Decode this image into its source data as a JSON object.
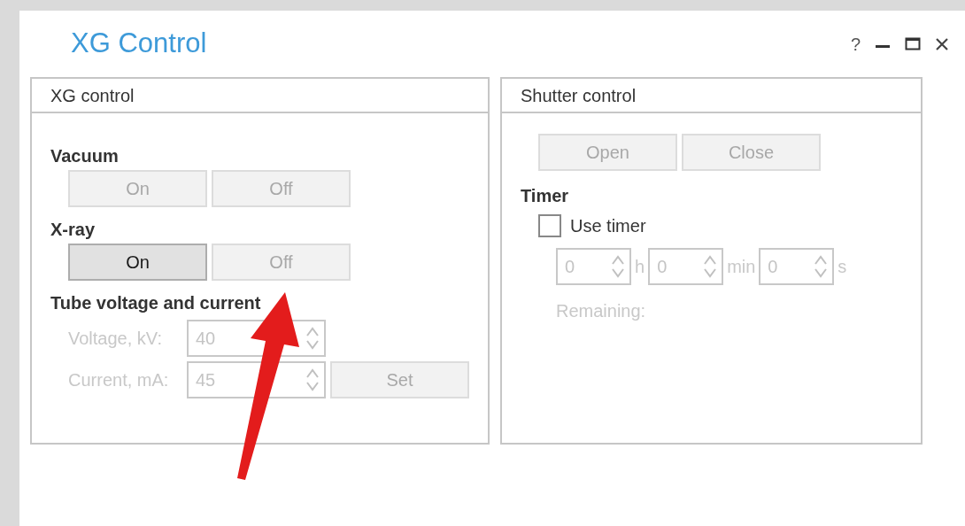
{
  "window": {
    "title": "XG Control",
    "help": "?"
  },
  "xg_panel": {
    "title": "XG control",
    "sections": [
      {
        "label": "Vacuum",
        "buttons": [
          {
            "label": "On",
            "disabled": true
          },
          {
            "label": "Off",
            "disabled": true
          }
        ]
      },
      {
        "label": "X-ray",
        "buttons": [
          {
            "label": "On",
            "disabled": false
          },
          {
            "label": "Off",
            "disabled": true
          }
        ]
      }
    ],
    "tube": {
      "label": "Tube voltage and current",
      "fields": [
        {
          "label": "Voltage, kV:",
          "value": "40",
          "disabled": true
        },
        {
          "label": "Current, mA:",
          "value": "45",
          "disabled": true
        }
      ],
      "set_button": {
        "label": "Set",
        "disabled": true
      }
    }
  },
  "shutter_panel": {
    "title": "Shutter control",
    "buttons": [
      {
        "label": "Open",
        "disabled": true
      },
      {
        "label": "Close",
        "disabled": true
      }
    ],
    "timer": {
      "label": "Timer",
      "use_timer": {
        "label": "Use timer",
        "checked": false
      },
      "fields": [
        {
          "value": "0",
          "unit": "h",
          "disabled": true
        },
        {
          "value": "0",
          "unit": "min",
          "disabled": true
        },
        {
          "value": "0",
          "unit": "s",
          "disabled": true
        }
      ],
      "remaining": "Remaining:"
    }
  }
}
